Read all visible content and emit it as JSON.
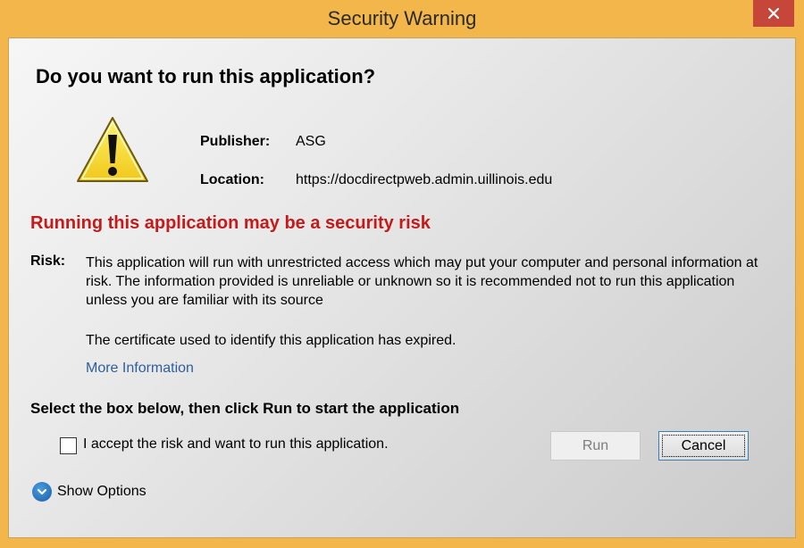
{
  "window": {
    "title": "Security Warning",
    "close_icon": "close-icon"
  },
  "dialog": {
    "question": "Do you want to run this application?",
    "warning_icon": "warning-triangle-icon",
    "publisher_label": "Publisher:",
    "publisher_value": "ASG",
    "location_label": "Location:",
    "location_value": "https://docdirectpweb.admin.uillinois.edu",
    "risk_heading": "Running this application may be a security risk",
    "risk_label": "Risk:",
    "risk_text": "This application will run with unrestricted access which may put your computer and personal information at risk. The information provided is unreliable or unknown so it is recommended not to run this application unless you are familiar with its source",
    "certificate_text": "The certificate used to identify this application has expired.",
    "more_information_link": "More Information",
    "select_heading": "Select the box below, then click Run to start the application",
    "checkbox_label": "I accept the risk and want to run this application.",
    "checkbox_checked": false,
    "run_button": "Run",
    "run_enabled": false,
    "cancel_button": "Cancel",
    "show_options_label": "Show Options",
    "show_options_icon": "chevron-down-circle-icon"
  },
  "colors": {
    "frame": "#f2b64a",
    "close_button": "#c7463a",
    "risk_heading": "#c41a1a",
    "link": "#2e5f9a"
  }
}
